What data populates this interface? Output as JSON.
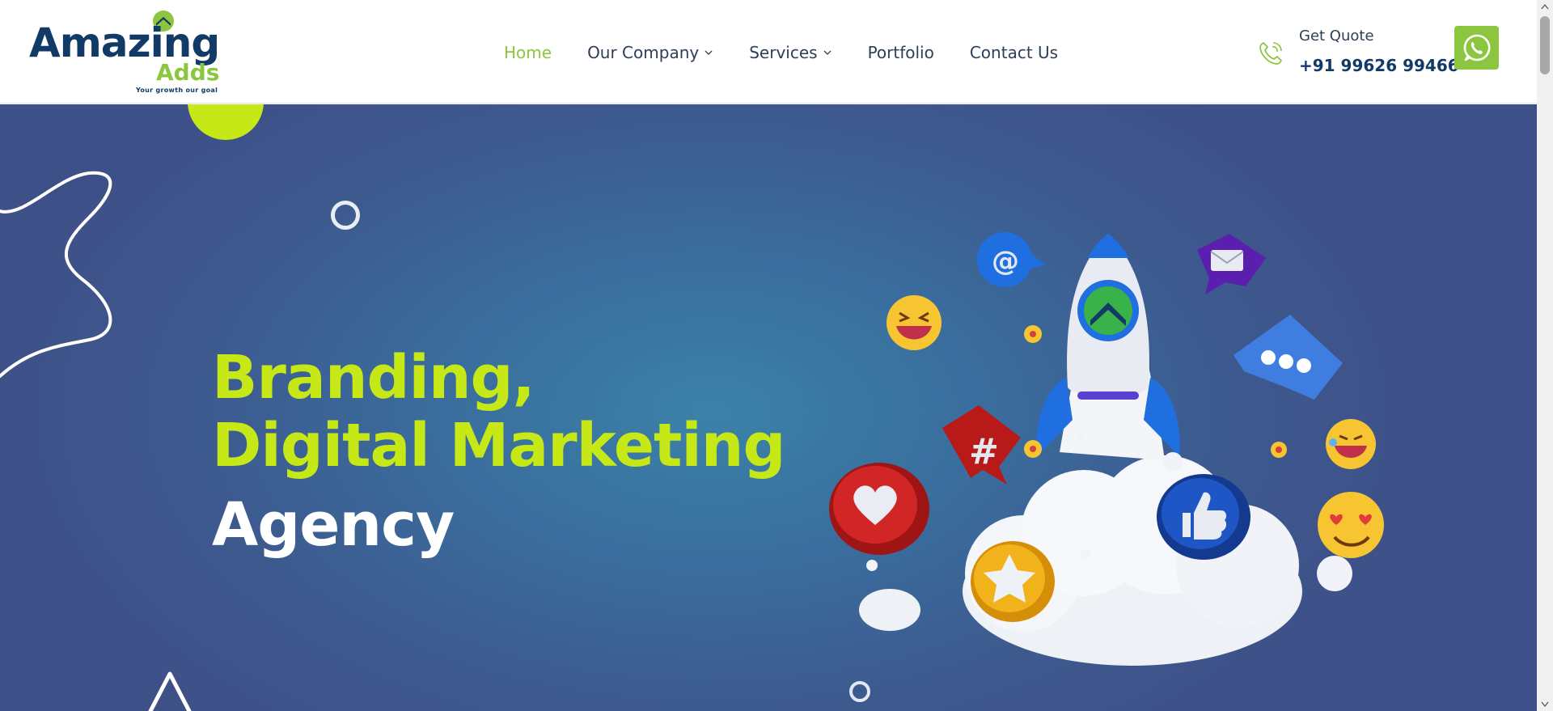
{
  "brand": {
    "word1": "Amazing",
    "word2": "Adds",
    "tagline": "Your growth our goal",
    "primary_color": "#123a66",
    "accent_color": "#8cc63f",
    "lime_color": "#c6e816"
  },
  "nav": {
    "items": [
      {
        "label": "Home",
        "active": true,
        "has_dropdown": false
      },
      {
        "label": "Our Company",
        "active": false,
        "has_dropdown": true
      },
      {
        "label": "Services",
        "active": false,
        "has_dropdown": true
      },
      {
        "label": "Portfolio",
        "active": false,
        "has_dropdown": false
      },
      {
        "label": "Contact Us",
        "active": false,
        "has_dropdown": false
      }
    ]
  },
  "contact": {
    "label": "Get Quote",
    "phone": "+91 99626 99466",
    "phone_icon": "phone-icon",
    "whatsapp_icon": "whatsapp-icon"
  },
  "hero": {
    "line1": "Branding,",
    "line2": "Digital Marketing",
    "line3": "Agency",
    "background_color": "#3d5a8f"
  }
}
